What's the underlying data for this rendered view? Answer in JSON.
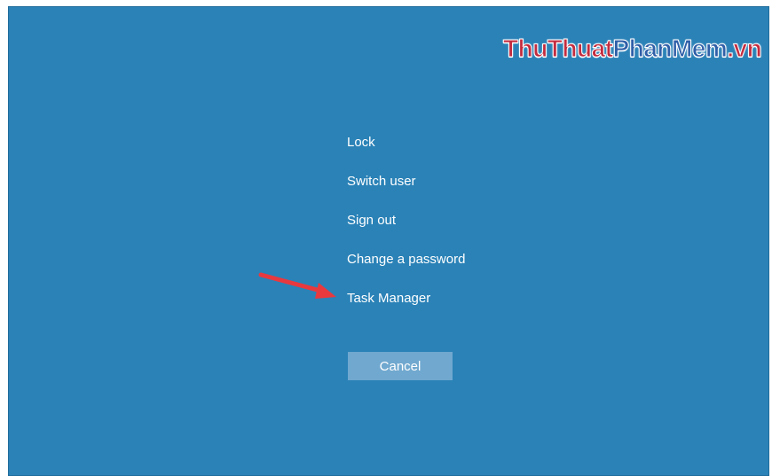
{
  "watermark": {
    "part1": "ThuThuat",
    "part2": "PhanMem",
    "part3": ".vn"
  },
  "menu": {
    "items": [
      {
        "label": "Lock"
      },
      {
        "label": "Switch user"
      },
      {
        "label": "Sign out"
      },
      {
        "label": "Change a password"
      },
      {
        "label": "Task Manager"
      }
    ]
  },
  "cancel_button": {
    "label": "Cancel"
  },
  "colors": {
    "background": "#2a82b7",
    "button": "#70a8cf",
    "arrow": "#e8393f"
  },
  "icons": {
    "annotation": "red-arrow-icon"
  }
}
